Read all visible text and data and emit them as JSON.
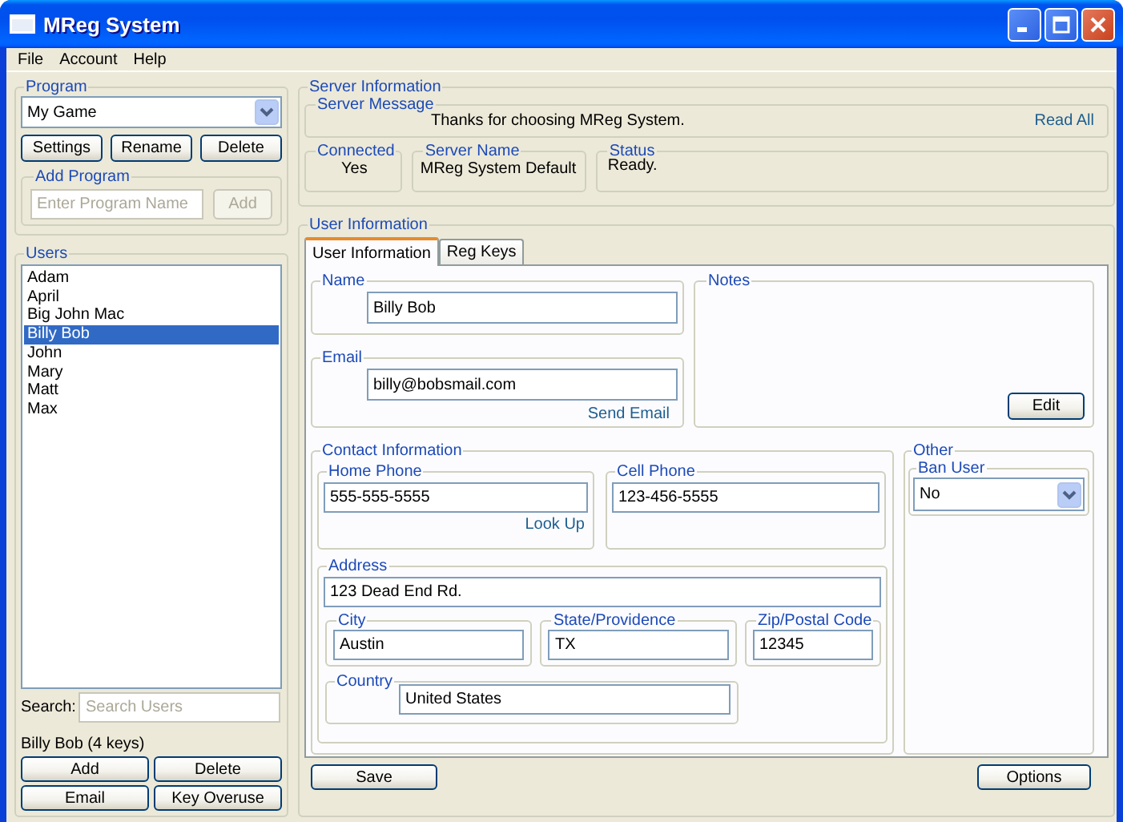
{
  "window": {
    "title": "MReg System"
  },
  "menu": [
    "File",
    "Account",
    "Help"
  ],
  "program": {
    "title": "Program",
    "selected": "My Game",
    "buttons": [
      "Settings",
      "Rename",
      "Delete"
    ],
    "add_program": {
      "title": "Add Program",
      "placeholder": "Enter Program Name",
      "button": {
        "label": "Add",
        "disabled": true
      }
    }
  },
  "users": {
    "title": "Users",
    "items": [
      {
        "label": "Adam",
        "selected": false
      },
      {
        "label": "April",
        "selected": false
      },
      {
        "label": "Big John Mac",
        "selected": false
      },
      {
        "label": "Billy Bob",
        "selected": true
      },
      {
        "label": "John",
        "selected": false
      },
      {
        "label": "Mary",
        "selected": false
      },
      {
        "label": "Matt",
        "selected": false
      },
      {
        "label": "Max",
        "selected": false
      }
    ],
    "search": {
      "label": "Search:",
      "placeholder": "Search Users"
    },
    "summary": "Billy Bob (4 keys)",
    "buttons": [
      "Add",
      "Delete",
      "Email",
      "Key Overuse"
    ]
  },
  "server_information": {
    "title": "Server Information",
    "server_message": {
      "title": "Server Message",
      "text": "Thanks for choosing MReg System.",
      "link": "Read All"
    },
    "connected": {
      "title": "Connected",
      "value": "Yes"
    },
    "server_name": {
      "title": "Server Name",
      "value": "MReg System Default"
    },
    "status": {
      "title": "Status",
      "value": "Ready."
    }
  },
  "user_information": {
    "title": "User Information",
    "tabs": [
      {
        "label": "User Information",
        "selected": true
      },
      {
        "label": "Reg Keys",
        "selected": false
      }
    ],
    "name": {
      "title": "Name",
      "value": "Billy Bob"
    },
    "email": {
      "title": "Email",
      "value": "billy@bobsmail.com",
      "link": "Send Email"
    },
    "notes": {
      "title": "Notes",
      "button": "Edit"
    },
    "contact": {
      "title": "Contact Information",
      "home_phone": {
        "title": "Home Phone",
        "value": "555-555-5555",
        "link": "Look Up"
      },
      "cell_phone": {
        "title": "Cell Phone",
        "value": "123-456-5555"
      },
      "address": {
        "title": "Address",
        "value": "123 Dead End Rd.",
        "city": {
          "title": "City",
          "value": "Austin"
        },
        "state": {
          "title": "State/Providence",
          "value": "TX"
        },
        "zip": {
          "title": "Zip/Postal Code",
          "value": "12345"
        },
        "country": {
          "title": "Country",
          "value": "United States"
        }
      }
    },
    "other": {
      "title": "Other",
      "ban_user": {
        "title": "Ban User",
        "value": "No"
      }
    },
    "buttons": [
      "Save",
      "Options"
    ]
  }
}
